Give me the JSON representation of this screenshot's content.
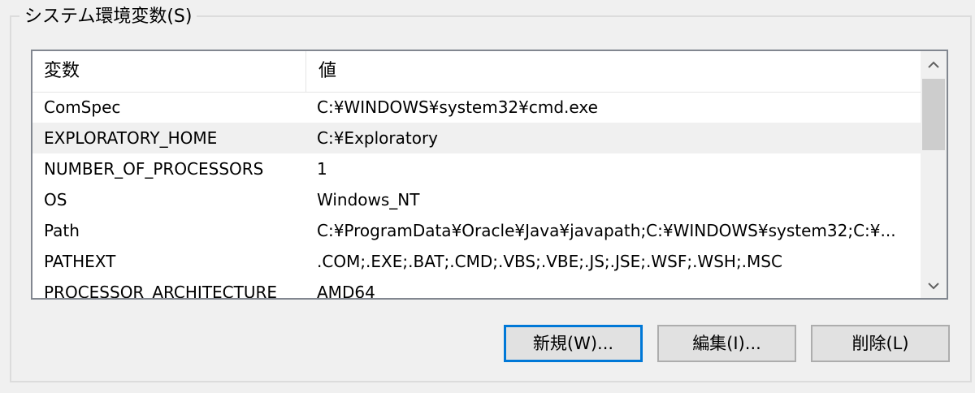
{
  "group": {
    "title": "システム環境変数(S)"
  },
  "list": {
    "columns": {
      "name": "変数",
      "value": "値"
    },
    "rows": [
      {
        "name": "ComSpec",
        "value": "C:¥WINDOWS¥system32¥cmd.exe",
        "selected": false
      },
      {
        "name": "EXPLORATORY_HOME",
        "value": "C:¥Exploratory",
        "selected": true
      },
      {
        "name": "NUMBER_OF_PROCESSORS",
        "value": "1",
        "selected": false
      },
      {
        "name": "OS",
        "value": "Windows_NT",
        "selected": false
      },
      {
        "name": "Path",
        "value": "C:¥ProgramData¥Oracle¥Java¥javapath;C:¥WINDOWS¥system32;C:¥...",
        "selected": false
      },
      {
        "name": "PATHEXT",
        "value": ".COM;.EXE;.BAT;.CMD;.VBS;.VBE;.JS;.JSE;.WSF;.WSH;.MSC",
        "selected": false
      },
      {
        "name": "PROCESSOR_ARCHITECTURE",
        "value": "AMD64",
        "selected": false
      }
    ]
  },
  "scrollbar": {
    "up_icon": "chevron-up-icon",
    "down_icon": "chevron-down-icon"
  },
  "buttons": {
    "new_label": "新規(W)...",
    "edit_label": "編集(I)...",
    "delete_label": "削除(L)"
  },
  "colors": {
    "focus_border": "#0078d7",
    "selected_row": "#f0f0f0",
    "background": "#f0f0f0"
  }
}
